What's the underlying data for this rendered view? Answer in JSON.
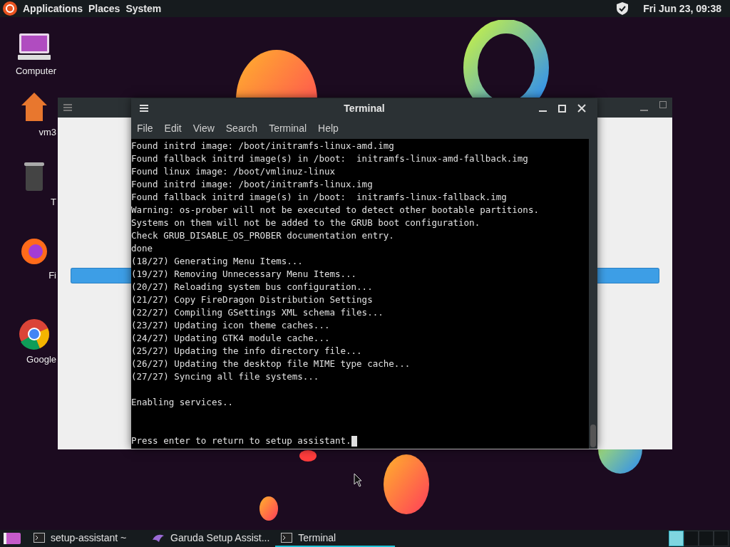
{
  "top_panel": {
    "menus": [
      "Applications",
      "Places",
      "System"
    ],
    "clock": "Fri Jun 23, 09:38"
  },
  "desktop_icons": [
    {
      "kind": "computer",
      "label": "Computer"
    },
    {
      "kind": "home",
      "label": "vm3"
    },
    {
      "kind": "trash",
      "label": "T"
    },
    {
      "kind": "firefox",
      "label": "Fi"
    },
    {
      "kind": "chrome",
      "label": "Google"
    }
  ],
  "terminal": {
    "title": "Terminal",
    "menu": [
      "File",
      "Edit",
      "View",
      "Search",
      "Terminal",
      "Help"
    ],
    "lines": [
      "Found initrd image: /boot/initramfs-linux-amd.img",
      "Found fallback initrd image(s) in /boot:  initramfs-linux-amd-fallback.img",
      "Found linux image: /boot/vmlinuz-linux",
      "Found initrd image: /boot/initramfs-linux.img",
      "Found fallback initrd image(s) in /boot:  initramfs-linux-fallback.img",
      "Warning: os-prober will not be executed to detect other bootable partitions.",
      "Systems on them will not be added to the GRUB boot configuration.",
      "Check GRUB_DISABLE_OS_PROBER documentation entry.",
      "done",
      "(18/27) Generating Menu Items...",
      "(19/27) Removing Unnecessary Menu Items...",
      "(20/27) Reloading system bus configuration...",
      "(21/27) Copy FireDragon Distribution Settings",
      "(22/27) Compiling GSettings XML schema files...",
      "(23/27) Updating icon theme caches...",
      "(24/27) Updating GTK4 module cache...",
      "(25/27) Updating the info directory file...",
      "(26/27) Updating the desktop file MIME type cache...",
      "(27/27) Syncing all file systems...",
      {
        "kind": "blank"
      },
      "Enabling services..",
      {
        "kind": "blank"
      },
      {
        "kind": "blank"
      },
      "Press enter to return to setup assistant."
    ]
  },
  "taskbar": {
    "tasks": [
      {
        "kind": "terminal",
        "label": "setup-assistant ~",
        "selected": false
      },
      {
        "kind": "bird",
        "label": "Garuda Setup Assist...",
        "selected": false
      },
      {
        "kind": "terminal",
        "label": "Terminal",
        "selected": true
      }
    ],
    "workspaces": [
      {
        "selected": true
      },
      {
        "selected": false
      },
      {
        "selected": false
      },
      {
        "selected": false
      }
    ]
  }
}
